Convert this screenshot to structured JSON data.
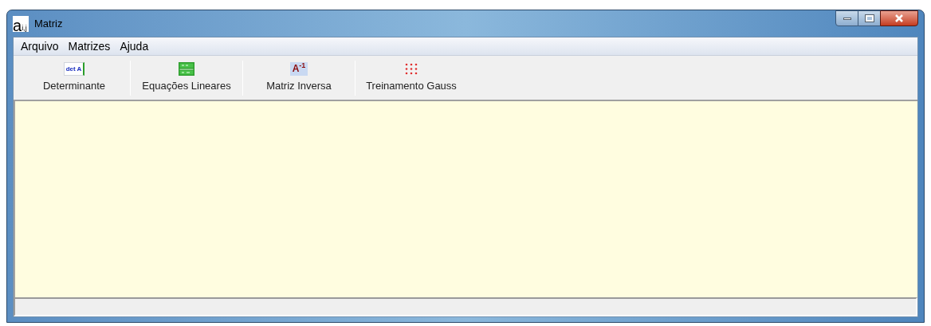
{
  "window": {
    "title": "Matriz",
    "app_icon": {
      "letter": "a",
      "subscript": "i,j"
    }
  },
  "menu": [
    "Arquivo",
    "Matrizes",
    "Ajuda"
  ],
  "toolbar": [
    {
      "label": "Determinante",
      "kind": "determinant",
      "icon_text": "det A"
    },
    {
      "label": "Equações Lineares",
      "kind": "equations"
    },
    {
      "label": "Matriz Inversa",
      "kind": "inverse",
      "icon_text": "A$^{-1}$"
    },
    {
      "label": "Treinamento Gauss",
      "kind": "gauss"
    }
  ]
}
